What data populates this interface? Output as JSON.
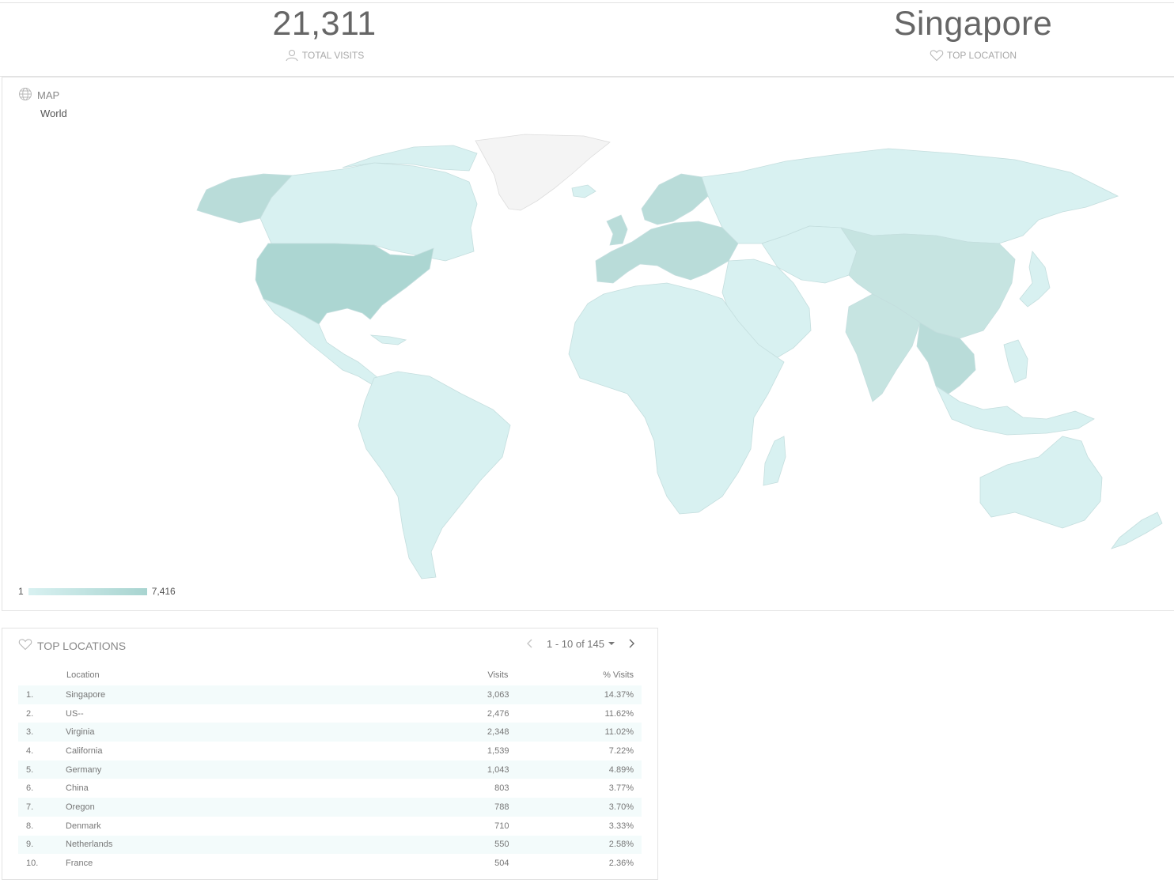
{
  "stats": {
    "total_visits_value": "21,311",
    "total_visits_label": "TOTAL VISITS",
    "top_location_value": "Singapore",
    "top_location_label": "TOP LOCATION"
  },
  "map": {
    "title": "MAP",
    "region": "World",
    "legend_min": "1",
    "legend_max": "7,416",
    "color_low": "#d8f1f1",
    "color_high": "#a8d4d0",
    "color_none": "#f4f4f4"
  },
  "top_locations": {
    "title": "TOP LOCATIONS",
    "pager_range": "1 - 10 of 145",
    "columns": {
      "location": "Location",
      "visits": "Visits",
      "pct": "% Visits"
    },
    "rows": [
      {
        "rank": "1.",
        "location": "Singapore",
        "visits": "3,063",
        "pct": "14.37%"
      },
      {
        "rank": "2.",
        "location": "US--",
        "visits": "2,476",
        "pct": "11.62%"
      },
      {
        "rank": "3.",
        "location": "Virginia",
        "visits": "2,348",
        "pct": "11.02%"
      },
      {
        "rank": "4.",
        "location": "California",
        "visits": "1,539",
        "pct": "7.22%"
      },
      {
        "rank": "5.",
        "location": "Germany",
        "visits": "1,043",
        "pct": "4.89%"
      },
      {
        "rank": "6.",
        "location": "China",
        "visits": "803",
        "pct": "3.77%"
      },
      {
        "rank": "7.",
        "location": "Oregon",
        "visits": "788",
        "pct": "3.70%"
      },
      {
        "rank": "8.",
        "location": "Denmark",
        "visits": "710",
        "pct": "3.33%"
      },
      {
        "rank": "9.",
        "location": "Netherlands",
        "visits": "550",
        "pct": "2.58%"
      },
      {
        "rank": "10.",
        "location": "France",
        "visits": "504",
        "pct": "2.36%"
      }
    ]
  }
}
